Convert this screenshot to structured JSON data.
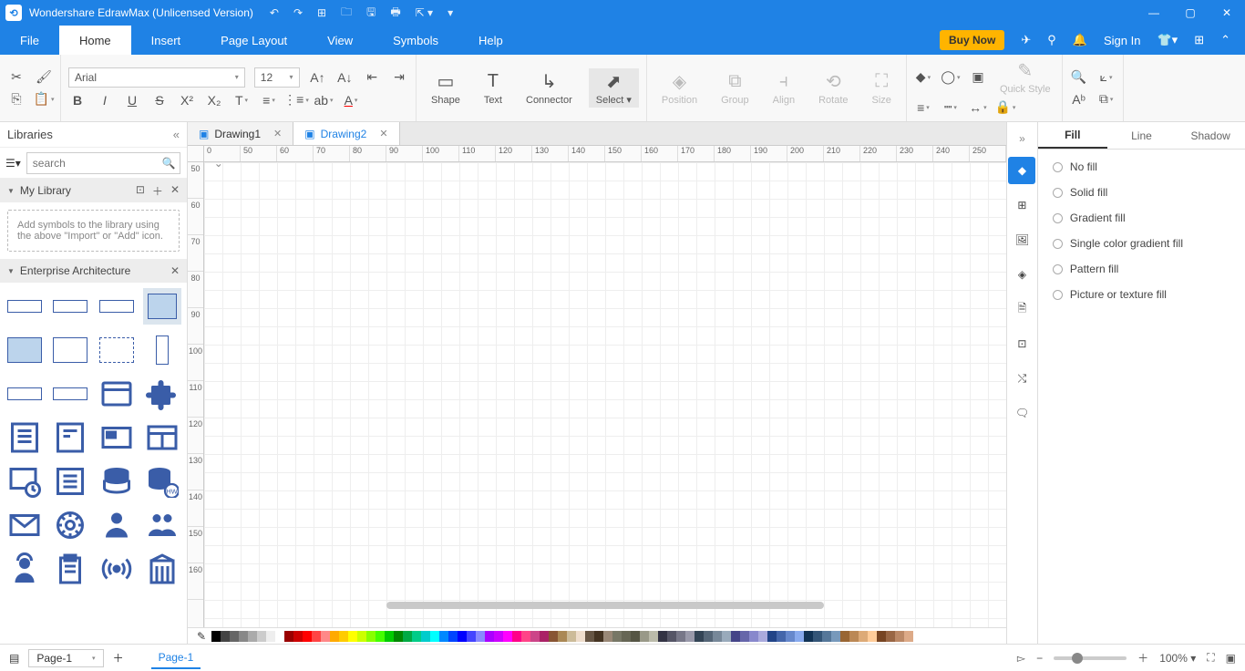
{
  "titlebar": {
    "title": "Wondershare EdrawMax (Unlicensed Version)"
  },
  "menu": {
    "tabs": [
      "File",
      "Home",
      "Insert",
      "Page Layout",
      "View",
      "Symbols",
      "Help"
    ],
    "active": 1,
    "buy": "Buy Now",
    "signin": "Sign In"
  },
  "ribbon": {
    "font": "Arial",
    "size": "12",
    "tools": {
      "shape": "Shape",
      "text": "Text",
      "connector": "Connector",
      "select": "Select",
      "position": "Position",
      "group": "Group",
      "align": "Align",
      "rotate": "Rotate",
      "size": "Size",
      "quick": "Quick Style"
    }
  },
  "libraries": {
    "title": "Libraries",
    "search_placeholder": "search",
    "mylib": "My Library",
    "hint": "Add symbols to the library using the above \"Import\" or \"Add\" icon.",
    "category": "Enterprise Architecture"
  },
  "doctabs": [
    {
      "label": "Drawing1",
      "active": false
    },
    {
      "label": "Drawing2",
      "active": true
    }
  ],
  "rulerH": [
    "0",
    "50",
    "60",
    "70",
    "80",
    "90",
    "100",
    "110",
    "120",
    "130",
    "140",
    "150",
    "160",
    "170",
    "180",
    "190",
    "200",
    "210",
    "220",
    "230",
    "240",
    "250"
  ],
  "rulerV": [
    "50",
    "60",
    "70",
    "80",
    "90",
    "100",
    "110",
    "120",
    "130",
    "140",
    "150",
    "160"
  ],
  "rightpanel": {
    "tabs": [
      "Fill",
      "Line",
      "Shadow"
    ],
    "activeTab": 0,
    "options": [
      "No fill",
      "Solid fill",
      "Gradient fill",
      "Single color gradient fill",
      "Pattern fill",
      "Picture or texture fill"
    ]
  },
  "status": {
    "page_select": "Page-1",
    "page_tab": "Page-1",
    "zoom": "100%"
  },
  "colors": [
    "#000",
    "#444",
    "#666",
    "#888",
    "#aaa",
    "#ccc",
    "#eee",
    "#fff",
    "#900",
    "#c00",
    "#f00",
    "#f44",
    "#f88",
    "#fa0",
    "#fc0",
    "#ff0",
    "#cf0",
    "#8f0",
    "#4f0",
    "#0c0",
    "#080",
    "#0a4",
    "#0c8",
    "#0cc",
    "#0ff",
    "#08f",
    "#04f",
    "#00f",
    "#44f",
    "#88f",
    "#a0f",
    "#c0f",
    "#f0f",
    "#f08",
    "#f48",
    "#c48",
    "#a26",
    "#853",
    "#a85",
    "#cb9",
    "#edc",
    "#654",
    "#432",
    "#987",
    "#776",
    "#665",
    "#554",
    "#998",
    "#bba",
    "#334",
    "#556",
    "#778",
    "#99a",
    "#345",
    "#567",
    "#789",
    "#9ab",
    "#448",
    "#66a",
    "#88c",
    "#aad",
    "#248",
    "#46a",
    "#68c",
    "#8ae",
    "#135",
    "#357",
    "#579",
    "#79b",
    "#963",
    "#b85",
    "#da7",
    "#fc9",
    "#742",
    "#964",
    "#b86",
    "#da8"
  ]
}
